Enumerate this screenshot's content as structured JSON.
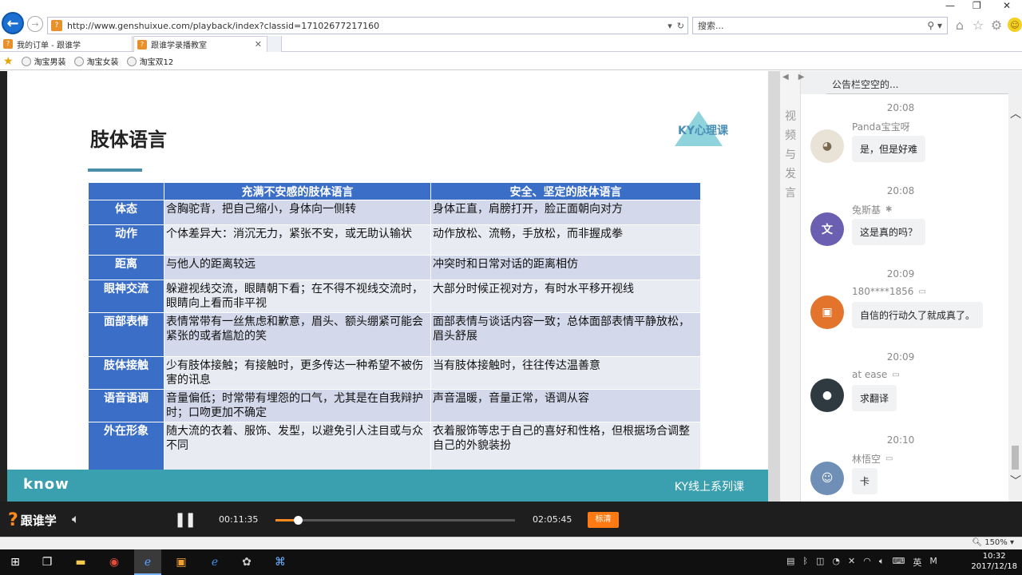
{
  "browser": {
    "url": "http://www.genshuixue.com/playback/index?classid=17102677217160",
    "search_placeholder": "搜索...",
    "tabs": [
      {
        "label": "我的订单 - 跟谁学"
      },
      {
        "label": "跟谁学录播教室"
      }
    ],
    "favorites": [
      {
        "label": "淘宝男装"
      },
      {
        "label": "淘宝女装"
      },
      {
        "label": "淘宝双12"
      }
    ]
  },
  "slide": {
    "title": "肢体语言",
    "brand": "KY心理课",
    "footer_left": "know",
    "footer_right": "KY线上系列课",
    "table": {
      "headers": [
        "",
        "充满不安感的肢体语言",
        "安全、坚定的肢体语言"
      ],
      "rows": [
        {
          "cat": "体态",
          "insecure": "含胸驼背，把自己缩小，身体向一侧转",
          "secure": "身体正直，肩膀打开，脸正面朝向对方"
        },
        {
          "cat": "动作",
          "insecure": "个体差异大：消沉无力，紧张不安，或无助认输状",
          "secure": "动作放松、流畅，手放松，而非握成拳"
        },
        {
          "cat": "距离",
          "insecure": "与他人的距离较远",
          "secure": "冲突时和日常对话的距离相仿"
        },
        {
          "cat": "眼神交流",
          "insecure": "躲避视线交流，眼睛朝下看；在不得不视线交流时，眼睛向上看而非平视",
          "secure": "大部分时候正视对方，有时水平移开视线"
        },
        {
          "cat": "面部表情",
          "insecure": "表情常带有一丝焦虑和歉意，眉头、额头绷紧可能会紧张的或者尴尬的笑",
          "secure": "面部表情与谈话内容一致；总体面部表情平静放松，眉头舒展"
        },
        {
          "cat": "肢体接触",
          "insecure": "少有肢体接触；有接触时，更多传达一种希望不被伤害的讯息",
          "secure": "当有肢体接触时，往往传达温善意"
        },
        {
          "cat": "语音语调",
          "insecure": "音量偏低；时常带有埋怨的口气，尤其是在自我辩护时；口吻更加不确定",
          "secure": "声音温暖，音量正常，语调从容"
        },
        {
          "cat": "外在形象",
          "insecure": "随大流的衣着、服饰、发型，以避免引人注目或与众不同",
          "secure": "衣着服饰等忠于自己的喜好和性格，但根据场合调整自己的外貌装扮"
        }
      ]
    }
  },
  "sidebar": {
    "vertical_label": "视频与发言",
    "notice": "公告栏空空的...",
    "messages": [
      {
        "time": "20:08",
        "user": "Panda宝宝呀",
        "device": "apple-icon",
        "text": "是，但是好难",
        "avatar_color": "#e9e2d6"
      },
      {
        "time": "20:08",
        "user": "兔斯基",
        "device": "android-icon",
        "text": "这是真的吗？",
        "avatar_color": "#6a5fb0"
      },
      {
        "time": "20:09",
        "user": "180****1856",
        "device": "pc-icon",
        "text": "自信的行动久了就成真了。",
        "avatar_color": "#e2742c"
      },
      {
        "time": "20:09",
        "user": "at ease",
        "device": "pc-icon",
        "text": "求翻译",
        "avatar_color": "#2e3a40"
      },
      {
        "time": "20:10",
        "user": "林悟空",
        "device": "pc-icon",
        "text": "卡",
        "avatar_color": "#6f8fb6"
      }
    ]
  },
  "player": {
    "brand": "跟谁学",
    "current_time": "00:11:35",
    "duration": "02:05:45",
    "progress_fraction": 0.092,
    "quality_label": "标清"
  },
  "status": {
    "zoom": "150%"
  },
  "taskbar": {
    "ime": "英",
    "time": "10:32",
    "date": "2017/12/18"
  }
}
